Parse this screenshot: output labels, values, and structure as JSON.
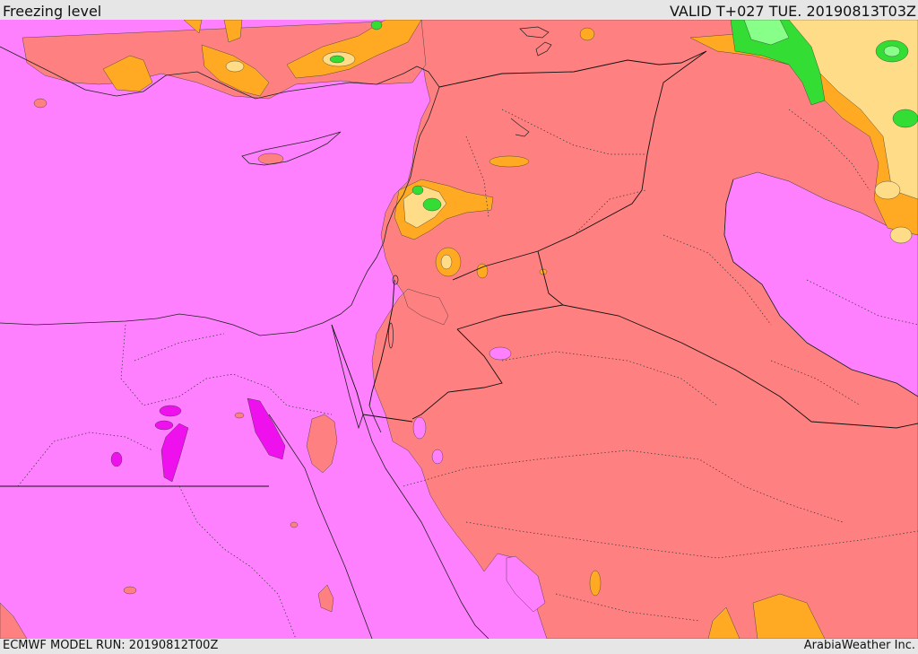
{
  "header": {
    "title": "Freezing level",
    "valid": "VALID T+027 TUE. 20190813T03Z"
  },
  "footer": {
    "model_run": "ECMWF MODEL RUN: 20190812T00Z",
    "credit": "ArabiaWeather Inc."
  },
  "legend_colors": {
    "very_high": "#ff80ff",
    "highest_patches": "#ee11ee",
    "high": "#ff8080",
    "mid": "#ffaa22",
    "lower": "#ffdd88",
    "low_green": "#33dd33",
    "lowest_green": "#88ff88"
  }
}
